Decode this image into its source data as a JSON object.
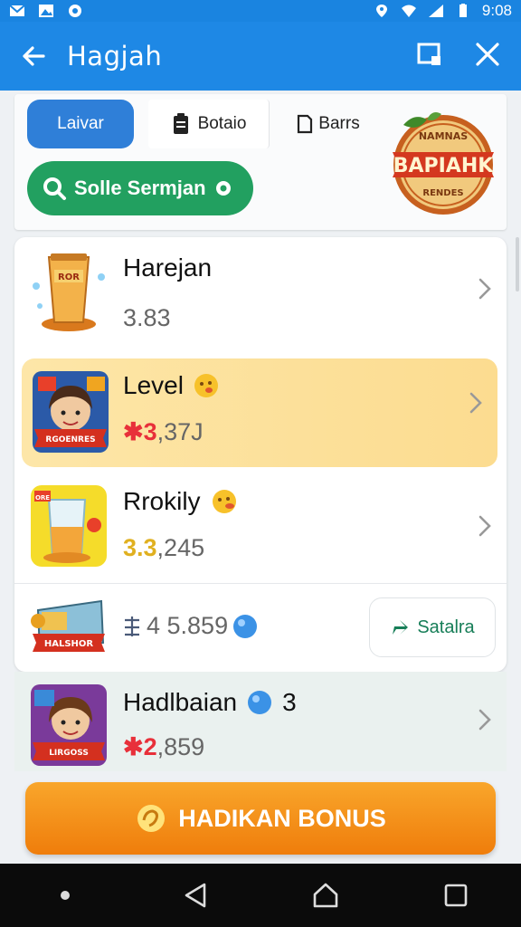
{
  "status_bar": {
    "time": "9:08"
  },
  "app_bar": {
    "title": "Hagjah"
  },
  "filters": {
    "primary_chip": "Laivar",
    "chip_a": "Botaio",
    "chip_b": "Barrs",
    "search_pill": "Solle Sermjan",
    "badge_text_main": "BAPIAHK",
    "badge_text_top": "NAMNAS",
    "badge_text_bottom": "RENDES"
  },
  "rows": [
    {
      "name": "Harejan",
      "value": "3.83",
      "thumb_text": "ROR"
    },
    {
      "name": "Level",
      "value_prefix": "✱3",
      "value_rest": ",37J",
      "thumb_text": "RGOENRES"
    },
    {
      "name": "Rrokily",
      "value_prefix": "3.3",
      "value_rest": ",245",
      "thumb_text": "ORE"
    },
    {
      "value": "4 5.859",
      "thumb_text": "HALSHOR",
      "status_label": "Satalra"
    },
    {
      "name": "Hadlbaian",
      "name_suffix": "3",
      "value_prefix": "✱2",
      "value_rest": ",859",
      "thumb_text": "LIRGOSS"
    }
  ],
  "bonus_button": "HADIKAN BONUS",
  "colors": {
    "primary": "#1e88e5",
    "green": "#22a060",
    "orange": "#f39419",
    "red": "#e8303a",
    "gold": "#e0b020"
  }
}
